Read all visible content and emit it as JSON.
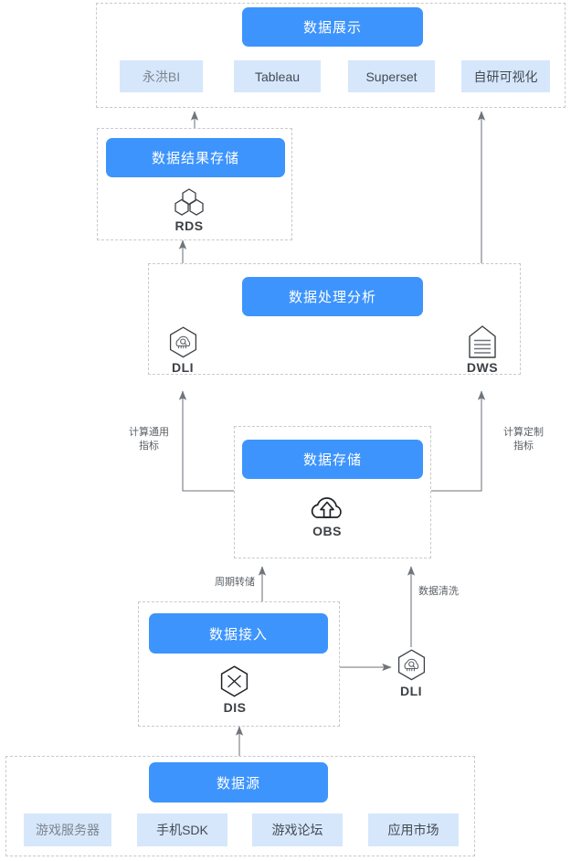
{
  "diagram": {
    "title_colors": {
      "primary_blue": "#3d94fc",
      "chip_blue": "#d6e7fb",
      "line_gray": "#8a8f95",
      "border_dash": "#c9c9c9",
      "text_dark": "#3c4044"
    },
    "layers": [
      {
        "id": "presentation",
        "header": "数据展示",
        "chips": [
          {
            "label": "永洪BI",
            "muted": true
          },
          {
            "label": "Tableau",
            "muted": false
          },
          {
            "label": "Superset",
            "muted": false
          },
          {
            "label": "自研可视化",
            "muted": false
          }
        ]
      },
      {
        "id": "result-storage",
        "header": "数据结果存储",
        "nodes": [
          {
            "name": "RDS",
            "icon": "rds-hexagons-icon"
          }
        ]
      },
      {
        "id": "processing",
        "header": "数据处理分析",
        "nodes": [
          {
            "name": "DLI",
            "icon": "dli-hexagon-cloud-icon"
          },
          {
            "name": "DWS",
            "icon": "dws-warehouse-icon"
          }
        ]
      },
      {
        "id": "storage",
        "header": "数据存储",
        "nodes": [
          {
            "name": "OBS",
            "icon": "obs-cloud-upload-icon"
          }
        ]
      },
      {
        "id": "ingestion",
        "header": "数据接入",
        "nodes": [
          {
            "name": "DIS",
            "icon": "dis-hexagon-cross-icon"
          }
        ]
      },
      {
        "id": "source",
        "header": "数据源",
        "chips": [
          {
            "label": "游戏服务器",
            "muted": true
          },
          {
            "label": "手机SDK",
            "muted": false
          },
          {
            "label": "游戏论坛",
            "muted": false
          },
          {
            "label": "应用市场",
            "muted": false
          }
        ]
      }
    ],
    "standalone_nodes": [
      {
        "name": "DLI",
        "icon": "dli-hexagon-cloud-icon"
      }
    ],
    "edge_labels": [
      {
        "id": "generic-metrics",
        "text": "计算通用\n指标"
      },
      {
        "id": "custom-metrics",
        "text": "计算定制\n指标"
      },
      {
        "id": "periodic-dump",
        "text": "周期转储"
      },
      {
        "id": "data-cleaning",
        "text": "数据清洗"
      }
    ]
  }
}
